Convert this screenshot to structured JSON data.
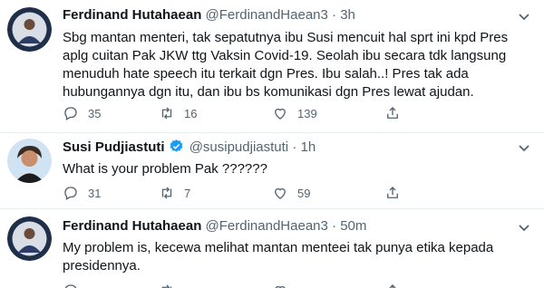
{
  "tweets": [
    {
      "name": "Ferdinand Hutahaean",
      "handle": "@FerdinandHaean3",
      "separator": "·",
      "time": "3h",
      "verified": false,
      "avatar_text": "RAKYAT BERGERAK BERSATU",
      "lines": [
        "Sbg mantan menteri, tak sepatutnya ibu Susi mencuit hal sprt ini kpd Pres",
        "aplg cuitan Pak JKW ttg Vaksin Covid-19. Seolah ibu secara tdk langsung",
        "menuduh hate speech itu terkait dgn Pres. Ibu salah..! Pres tak ada",
        "hubungannya dgn itu, dan ibu bs komunikasi dgn Pres lewat ajudan."
      ],
      "reply_count": "35",
      "retweet_count": "16",
      "like_count": "139"
    },
    {
      "name": "Susi Pudjiastuti",
      "handle": "@susipudjiastuti",
      "separator": "·",
      "time": "1h",
      "verified": true,
      "lines": [
        "What is your problem Pak ??????"
      ],
      "reply_count": "31",
      "retweet_count": "7",
      "like_count": "59"
    },
    {
      "name": "Ferdinand Hutahaean",
      "handle": "@FerdinandHaean3",
      "separator": "·",
      "time": "50m",
      "verified": false,
      "avatar_text": "RAKYAT BERGERAK BERSATU",
      "lines": [
        "My problem is, kecewa melihat mantan menteei tak punya etika kepada",
        "presidennya."
      ]
    }
  ],
  "colors": {
    "text": "#0f1419",
    "muted": "#536471",
    "verified": "#1d9bf0",
    "divider": "#e6ecf0"
  },
  "icons": [
    "reply-icon",
    "retweet-icon",
    "like-icon",
    "share-icon",
    "caret-down-icon",
    "verified-badge-icon"
  ]
}
